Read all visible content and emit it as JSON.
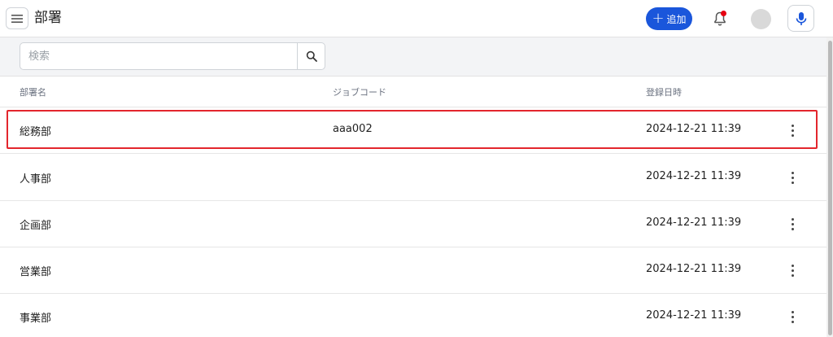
{
  "header": {
    "title": "部署",
    "add_label": "追加"
  },
  "search": {
    "placeholder": "検索",
    "value": ""
  },
  "table": {
    "columns": [
      "部署名",
      "ジョブコード",
      "登録日時"
    ],
    "rows": [
      {
        "name": "総務部",
        "job_code": "aaa002",
        "registered": "2024-12-21 11:39"
      },
      {
        "name": "人事部",
        "job_code": "",
        "registered": "2024-12-21 11:39"
      },
      {
        "name": "企画部",
        "job_code": "",
        "registered": "2024-12-21 11:39"
      },
      {
        "name": "営業部",
        "job_code": "",
        "registered": "2024-12-21 11:39"
      },
      {
        "name": "事業部",
        "job_code": "",
        "registered": "2024-12-21 11:39"
      }
    ]
  },
  "colors": {
    "accent": "#1a56db",
    "highlight": "#e3262d",
    "notification_dot": "#e60012"
  },
  "icons": {
    "menu": "hamburger-menu-icon",
    "add": "plus-icon",
    "notification": "bell-icon",
    "mic": "microphone-icon",
    "search": "search-icon",
    "row_menu": "more-vertical-icon"
  }
}
